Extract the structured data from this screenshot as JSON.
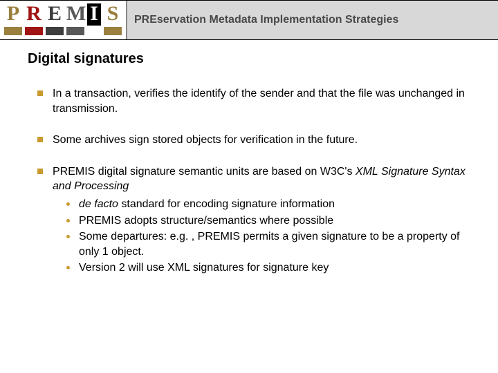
{
  "header": {
    "logo_letters": [
      "P",
      "R",
      "E",
      "M",
      "I",
      "S"
    ],
    "subtitle_html": "PREservation Metadata Implementation Strategies"
  },
  "title": "Digital signatures",
  "bullets": [
    {
      "text": "In a transaction, verifies the identify of the sender and that the file was unchanged in transmission."
    },
    {
      "text": "Some archives sign stored objects for verification in the future."
    },
    {
      "text_prefix": "PREMIS digital signature semantic units are based on W3C's ",
      "text_ital": "XML Signature Syntax and Processing",
      "sub": [
        {
          "ital": "de facto",
          "rest": " standard for encoding signature information"
        },
        {
          "text": "PREMIS adopts structure/semantics where possible"
        },
        {
          "text": "Some departures: e.g. , PREMIS permits a given signature to be a property of only 1 object."
        },
        {
          "text": "Version 2 will use XML signatures for signature key"
        }
      ]
    }
  ]
}
